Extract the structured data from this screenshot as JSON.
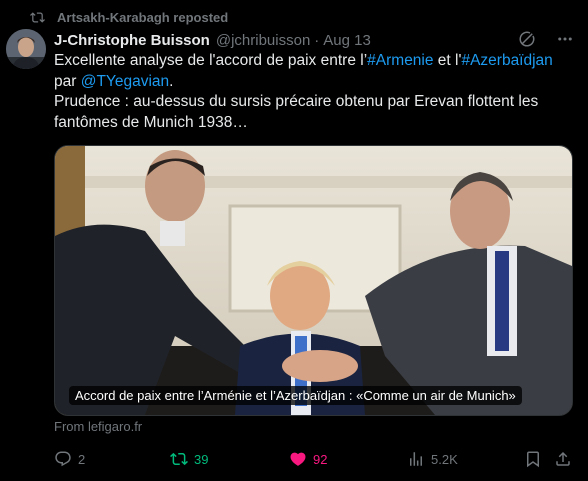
{
  "repost": {
    "label": "Artsakh-Karabagh reposted"
  },
  "author": {
    "name": "J-Christophe Buisson",
    "handle": "@jchribuisson",
    "date": "Aug 13"
  },
  "tweet": {
    "line1_a": "Excellente analyse de l'accord de paix entre l’",
    "tag1": "#Armenie",
    "line1_b": " et l'",
    "tag2": "#Azerbaïdjan",
    "line2_a": "par ",
    "mention": "@TYegavian",
    "line2_b": ".",
    "line3": "Prudence : au-dessus du sursis précaire obtenu par Erevan flottent les fantômes de Munich 1938…"
  },
  "card": {
    "title": "Accord de paix entre l’Arménie et l’Azerbaïdjan : «Comme un air de Munich»",
    "source": "From lefigaro.fr"
  },
  "actions": {
    "replies": "2",
    "reposts": "39",
    "likes": "92",
    "views": "5.2K"
  },
  "colors": {
    "background": "#000000",
    "text": "#e7e9ea",
    "muted": "#71767b",
    "link": "#1d9bf0",
    "repost_green": "#00ba7c",
    "like_pink": "#f91880"
  },
  "icons": {
    "repost": "repost-icon",
    "grok": "grok-icon",
    "more": "more-icon",
    "reply": "reply-icon",
    "like": "heart-icon",
    "views": "views-icon",
    "bookmark": "bookmark-icon",
    "share": "share-icon"
  }
}
